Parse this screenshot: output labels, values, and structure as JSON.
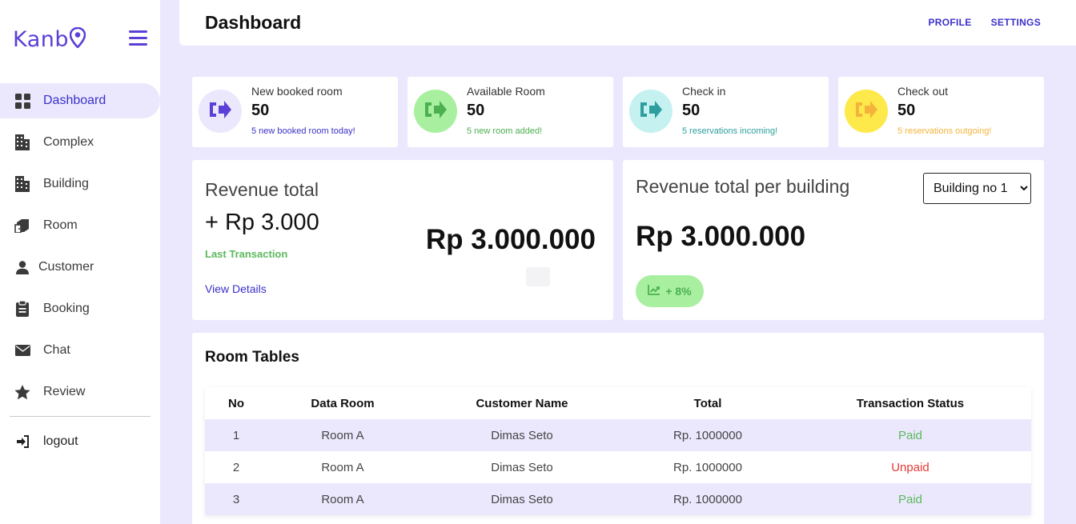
{
  "brand": {
    "name_prefix": "Kanb",
    "accent": "#5b3fd6"
  },
  "sidebar": {
    "items": [
      {
        "label": "Dashboard",
        "icon": "grid-icon",
        "active": true
      },
      {
        "label": "Complex",
        "icon": "building-icon"
      },
      {
        "label": "Building",
        "icon": "building-icon"
      },
      {
        "label": "Room",
        "icon": "door-icon"
      },
      {
        "label": "Customer",
        "icon": "user-icon"
      },
      {
        "label": "Booking",
        "icon": "clipboard-icon"
      },
      {
        "label": "Chat",
        "icon": "envelope-icon"
      },
      {
        "label": "Review",
        "icon": "star-icon"
      }
    ],
    "logout_label": "logout"
  },
  "header": {
    "title": "Dashboard",
    "profile_label": "PROFILE",
    "settings_label": "SETTINGS"
  },
  "stats": [
    {
      "label": "New booked room",
      "value": "50",
      "sub": "5 new booked room today!",
      "circle_color": "#ebe8fd",
      "icon_color": "#5b3fd6",
      "sub_color": "#3b30c9"
    },
    {
      "label": "Available Room",
      "value": "50",
      "sub": "5 new room added!",
      "circle_color": "#a8f0a0",
      "icon_color": "#4caf50",
      "sub_color": "#4caf50"
    },
    {
      "label": "Check in",
      "value": "50",
      "sub": "5 reservations incoming!",
      "circle_color": "#c5f1f1",
      "icon_color": "#2e9e9e",
      "sub_color": "#2e9e9e"
    },
    {
      "label": "Check out",
      "value": "50",
      "sub": "5 reservations outgoing!",
      "circle_color": "#fde94a",
      "icon_color": "#f4b43c",
      "sub_color": "#f4b43c"
    }
  ],
  "revenue": {
    "title": "Revenue total",
    "change": "+ Rp 3.000",
    "last_label": "Last Transaction",
    "details_label": "View Details",
    "amount": "Rp 3.000.000"
  },
  "revenue_building": {
    "title": "Revenue total per building",
    "selected_building": "Building no 1",
    "amount": "Rp 3.000.000",
    "trend": "+ 8%"
  },
  "room_table": {
    "title": "Room Tables",
    "headers": [
      "No",
      "Data Room",
      "Customer Name",
      "Total",
      "Transaction Status"
    ],
    "rows": [
      {
        "no": "1",
        "room": "Room A",
        "customer": "Dimas Seto",
        "total": "Rp. 1000000",
        "status": "Paid"
      },
      {
        "no": "2",
        "room": "Room A",
        "customer": "Dimas Seto",
        "total": "Rp. 1000000",
        "status": "Unpaid"
      },
      {
        "no": "3",
        "room": "Room A",
        "customer": "Dimas Seto",
        "total": "Rp. 1000000",
        "status": "Paid"
      }
    ]
  }
}
